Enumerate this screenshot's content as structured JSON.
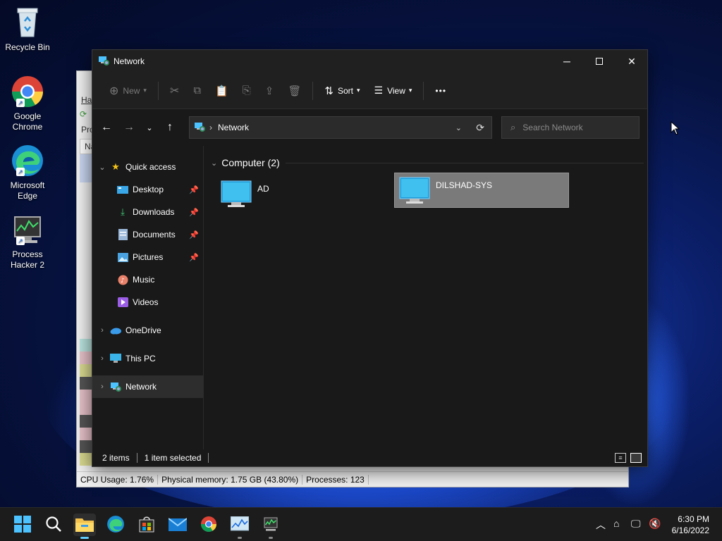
{
  "desktop": {
    "icons": [
      {
        "label": "Recycle Bin",
        "icon": "recycle-bin-icon"
      },
      {
        "label": "Google Chrome",
        "icon": "chrome-icon"
      },
      {
        "label": "Microsoft Edge",
        "icon": "edge-icon"
      },
      {
        "label": "Process Hacker 2",
        "icon": "process-hacker-icon"
      }
    ]
  },
  "process_hacker": {
    "menu_fragment": "Ha",
    "tab_fragment": "Pro",
    "col_fragment": "Na",
    "status": {
      "cpu": "CPU Usage: 1.76%",
      "memory": "Physical memory: 1.75 GB (43.80%)",
      "processes": "Processes: 123"
    }
  },
  "explorer": {
    "title": "Network",
    "toolbar": {
      "new_label": "New",
      "sort_label": "Sort",
      "view_label": "View",
      "more_label": "•••"
    },
    "address": {
      "crumb": "Network"
    },
    "search": {
      "placeholder": "Search Network"
    },
    "nav": {
      "quick_access": "Quick access",
      "items": [
        {
          "label": "Desktop",
          "pinned": true
        },
        {
          "label": "Downloads",
          "pinned": true
        },
        {
          "label": "Documents",
          "pinned": true
        },
        {
          "label": "Pictures",
          "pinned": true
        },
        {
          "label": "Music",
          "pinned": false
        },
        {
          "label": "Videos",
          "pinned": false
        }
      ],
      "onedrive": "OneDrive",
      "this_pc": "This PC",
      "network": "Network"
    },
    "group": {
      "label": "Computer (2)"
    },
    "computers": [
      {
        "name": "AD",
        "selected": false
      },
      {
        "name": "DILSHAD-SYS",
        "selected": true
      }
    ],
    "status": {
      "items": "2 items",
      "selected": "1 item selected"
    }
  },
  "taskbar": {
    "time": "6:30 PM",
    "date": "6/16/2022"
  },
  "colors": {
    "accent": "#60cdff",
    "explorer_bg": "#191919",
    "selection": "#7a7a7a"
  }
}
